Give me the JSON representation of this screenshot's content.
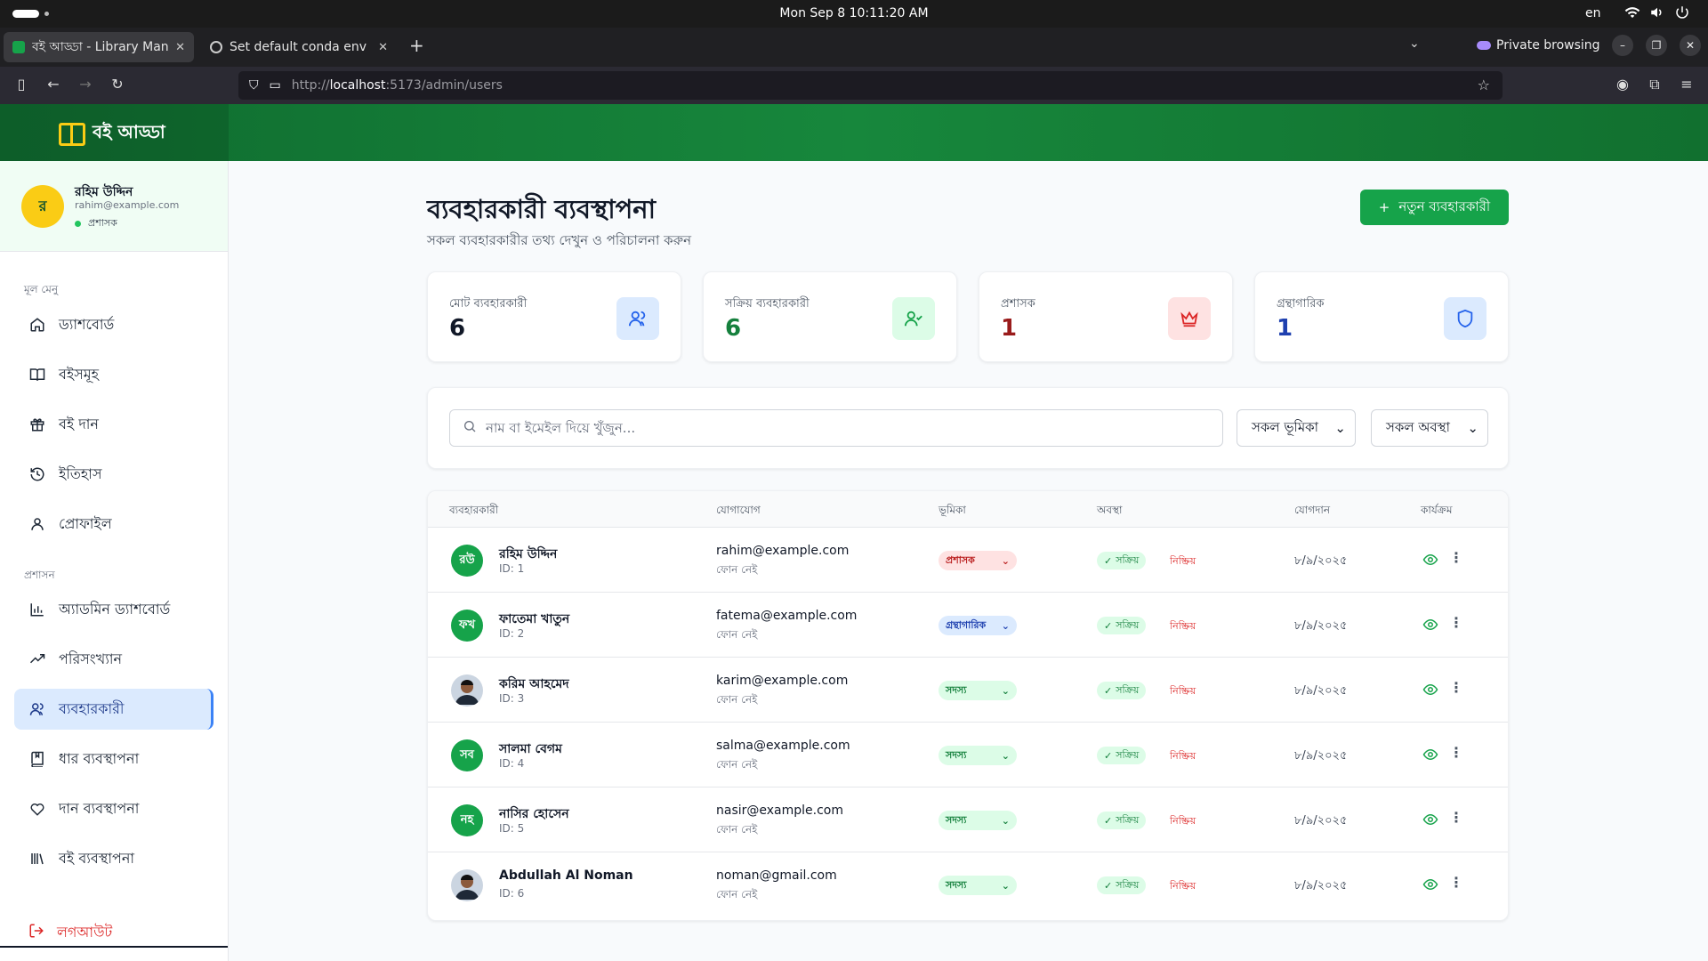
{
  "os": {
    "clock": "Mon Sep 8  10:11:20 AM",
    "lang": "en"
  },
  "browser": {
    "tabs": [
      {
        "title": "বই আড্ডা - Library Manager",
        "active": true
      },
      {
        "title": "Set default conda env",
        "active": false
      }
    ],
    "private_label": "Private browsing",
    "url_prefix": "http://",
    "url_host": "localhost",
    "url_rest": ":5173/admin/users"
  },
  "app": {
    "brand": "বই আড্ডা",
    "user": {
      "avatar": "র",
      "name": "রহিম উদ্দিন",
      "email": "rahim@example.com",
      "role": "প্রশাসক"
    },
    "menu_label": "মূল মেনু",
    "menu": [
      {
        "label": "ড্যাশবোর্ড",
        "icon": "home-icon"
      },
      {
        "label": "বইসমূহ",
        "icon": "book-icon"
      },
      {
        "label": "বই দান",
        "icon": "gift-icon"
      },
      {
        "label": "ইতিহাস",
        "icon": "history-icon"
      },
      {
        "label": "প্রোফাইল",
        "icon": "user-icon"
      }
    ],
    "admin_label": "প্রশাসন",
    "admin_menu": [
      {
        "label": "অ্যাডমিন ড্যাশবোর্ড",
        "icon": "bar-chart-icon"
      },
      {
        "label": "পরিসংখ্যান",
        "icon": "trending-icon"
      },
      {
        "label": "ব্যবহারকারী",
        "icon": "users-icon",
        "active": true
      },
      {
        "label": "ধার ব্যবস্থাপনা",
        "icon": "book-marked-icon"
      },
      {
        "label": "দান ব্যবস্থাপনা",
        "icon": "hand-heart-icon"
      },
      {
        "label": "বই ব্যবস্থাপনা",
        "icon": "library-icon"
      }
    ],
    "logout": "লগআউট"
  },
  "page": {
    "title": "ব্যবহারকারী ব্যবস্থাপনা",
    "subtitle": "সকল ব্যবহারকারীর তথ্য দেখুন ও পরিচালনা করুন",
    "add_button": "নতুন ব্যবহারকারী"
  },
  "stats": [
    {
      "label": "মোট ব্যবহারকারী",
      "value": "6",
      "color": "#111827",
      "bg": "#dbeafe",
      "icon_color": "#2563eb",
      "icon": "users-icon"
    },
    {
      "label": "সক্রিয় ব্যবহারকারী",
      "value": "6",
      "color": "#15803d",
      "bg": "#dcfce7",
      "icon_color": "#16a34a",
      "icon": "user-check-icon"
    },
    {
      "label": "প্রশাসক",
      "value": "1",
      "color": "#991b1b",
      "bg": "#fee2e2",
      "icon_color": "#dc2626",
      "icon": "crown-icon"
    },
    {
      "label": "গ্রন্থাগারিক",
      "value": "1",
      "color": "#1e40af",
      "bg": "#dbeafe",
      "icon_color": "#2563eb",
      "icon": "shield-icon"
    }
  ],
  "filters": {
    "search_placeholder": "নাম বা ইমেইল দিয়ে খুঁজুন...",
    "role_select": "সকল ভূমিকা",
    "status_select": "সকল অবস্থা"
  },
  "table": {
    "headers": [
      "ব্যবহারকারী",
      "যোগাযোগ",
      "ভূমিকা",
      "অবস্থা",
      "যোগদান",
      "কার্যক্রম"
    ],
    "rows": [
      {
        "initials": "রউ",
        "name": "রহিম উদ্দিন",
        "id": "ID: 1",
        "email": "rahim@example.com",
        "phone": "ফোন নেই",
        "role": "প্রশাসক",
        "role_kind": "admin",
        "active": "সক্রিয়",
        "inactive": "নিষ্ক্রিয়",
        "joined": "৮/৯/২০২৫",
        "avatar_kind": "initials"
      },
      {
        "initials": "ফখ",
        "name": "ফাতেমা খাতুন",
        "id": "ID: 2",
        "email": "fatema@example.com",
        "phone": "ফোন নেই",
        "role": "গ্রন্থাগারিক",
        "role_kind": "librarian",
        "active": "সক্রিয়",
        "inactive": "নিষ্ক্রিয়",
        "joined": "৮/৯/২০২৫",
        "avatar_kind": "initials"
      },
      {
        "initials": "",
        "name": "করিম আহমেদ",
        "id": "ID: 3",
        "email": "karim@example.com",
        "phone": "ফোন নেই",
        "role": "সদস্য",
        "role_kind": "member",
        "active": "সক্রিয়",
        "inactive": "নিষ্ক্রিয়",
        "joined": "৮/৯/২০২৫",
        "avatar_kind": "photo"
      },
      {
        "initials": "সব",
        "name": "সালমা বেগম",
        "id": "ID: 4",
        "email": "salma@example.com",
        "phone": "ফোন নেই",
        "role": "সদস্য",
        "role_kind": "member",
        "active": "সক্রিয়",
        "inactive": "নিষ্ক্রিয়",
        "joined": "৮/৯/২০২৫",
        "avatar_kind": "initials"
      },
      {
        "initials": "নহ",
        "name": "নাসির হোসেন",
        "id": "ID: 5",
        "email": "nasir@example.com",
        "phone": "ফোন নেই",
        "role": "সদস্য",
        "role_kind": "member",
        "active": "সক্রিয়",
        "inactive": "নিষ্ক্রিয়",
        "joined": "৮/৯/২০২৫",
        "avatar_kind": "initials"
      },
      {
        "initials": "",
        "name": "Abdullah Al Noman",
        "id": "ID: 6",
        "email": "noman@gmail.com",
        "phone": "ফোন নেই",
        "role": "সদস্য",
        "role_kind": "member",
        "active": "সক্রিয়",
        "inactive": "নিষ্ক্রিয়",
        "joined": "৮/৯/২০২৫",
        "avatar_kind": "photo"
      }
    ]
  },
  "colors": {
    "brand_green": "#16a34a",
    "sidebar_active": "#dbeafe",
    "danger": "#dc2626"
  }
}
